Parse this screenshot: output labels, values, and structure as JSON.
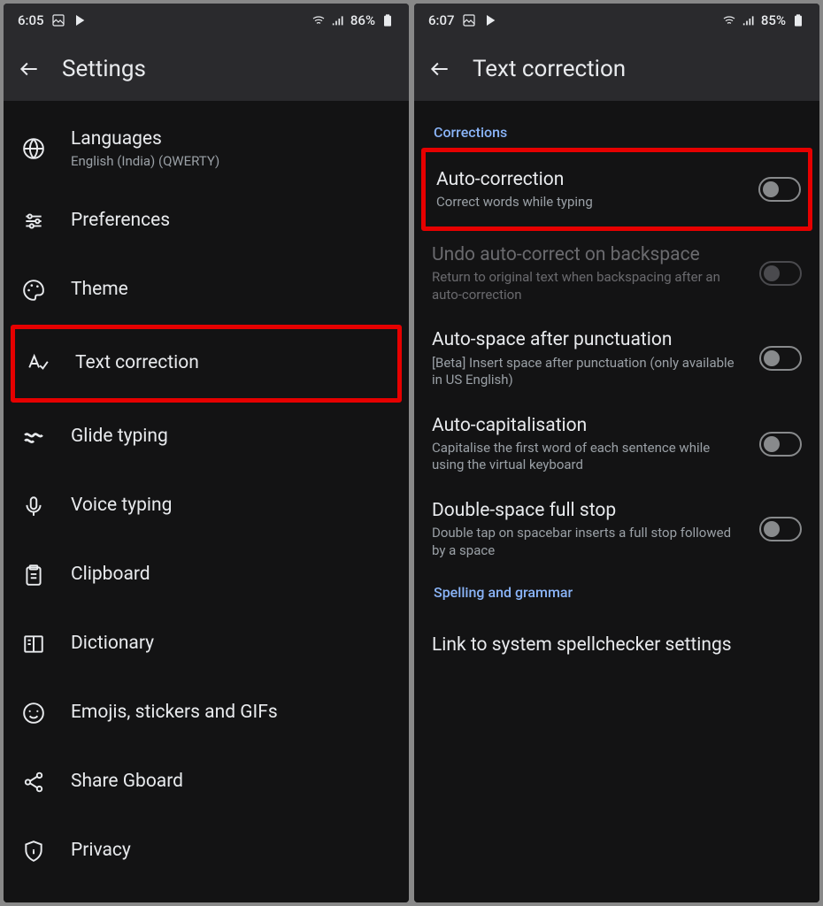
{
  "left": {
    "status": {
      "time": "6:05",
      "battery": "86%"
    },
    "title": "Settings",
    "items": [
      {
        "title": "Languages",
        "sub": "English (India) (QWERTY)"
      },
      {
        "title": "Preferences"
      },
      {
        "title": "Theme"
      },
      {
        "title": "Text correction"
      },
      {
        "title": "Glide typing"
      },
      {
        "title": "Voice typing"
      },
      {
        "title": "Clipboard"
      },
      {
        "title": "Dictionary"
      },
      {
        "title": "Emojis, stickers and GIFs"
      },
      {
        "title": "Share Gboard"
      },
      {
        "title": "Privacy"
      }
    ]
  },
  "right": {
    "status": {
      "time": "6:07",
      "battery": "85%"
    },
    "title": "Text correction",
    "section1": "Corrections",
    "items": [
      {
        "title": "Auto-correction",
        "sub": "Correct words while typing"
      },
      {
        "title": "Undo auto-correct on backspace",
        "sub": "Return to original text when backspacing after an auto-correction"
      },
      {
        "title": "Auto-space after punctuation",
        "sub": "[Beta] Insert space after punctuation (only available in US English)"
      },
      {
        "title": "Auto-capitalisation",
        "sub": "Capitalise the first word of each sentence while using the virtual keyboard"
      },
      {
        "title": "Double-space full stop",
        "sub": "Double tap on spacebar inserts a full stop followed by a space"
      }
    ],
    "section2": "Spelling and grammar",
    "link_item": "Link to system spellchecker settings"
  }
}
